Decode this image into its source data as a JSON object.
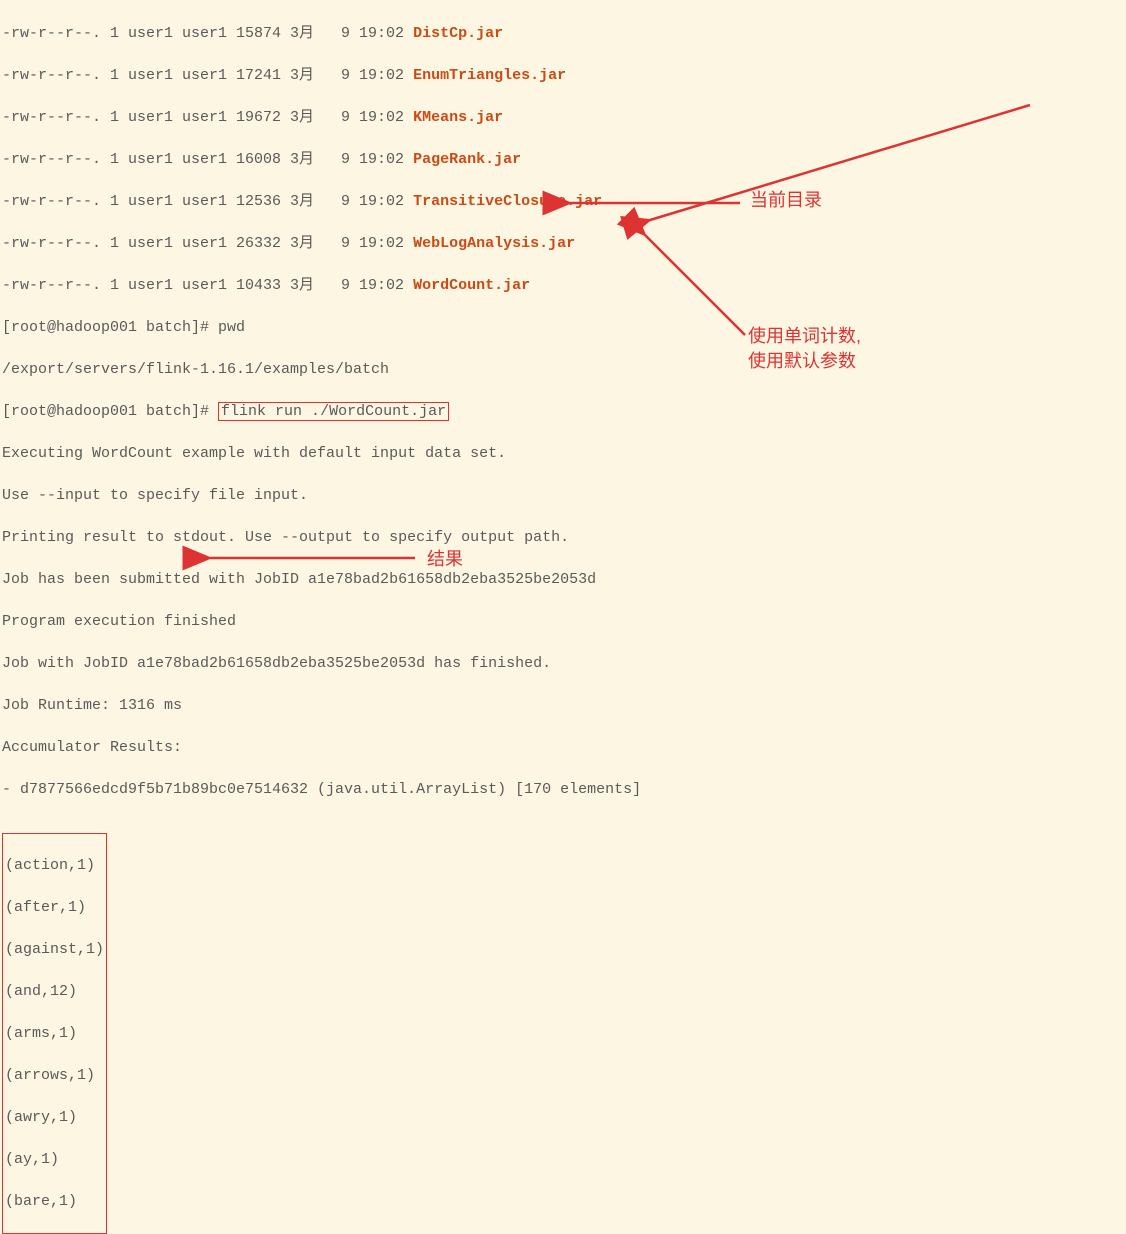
{
  "files": [
    {
      "perms": "-rw-r--r--. 1 user1 user1 15874 3月   9 19:02 ",
      "name": "DistCp.jar"
    },
    {
      "perms": "-rw-r--r--. 1 user1 user1 17241 3月   9 19:02 ",
      "name": "EnumTriangles.jar"
    },
    {
      "perms": "-rw-r--r--. 1 user1 user1 19672 3月   9 19:02 ",
      "name": "KMeans.jar"
    },
    {
      "perms": "-rw-r--r--. 1 user1 user1 16008 3月   9 19:02 ",
      "name": "PageRank.jar"
    },
    {
      "perms": "-rw-r--r--. 1 user1 user1 12536 3月   9 19:02 ",
      "name": "TransitiveClosure.jar"
    },
    {
      "perms": "-rw-r--r--. 1 user1 user1 26332 3月   9 19:02 ",
      "name": "WebLogAnalysis.jar"
    },
    {
      "perms": "-rw-r--r--. 1 user1 user1 10433 3月   9 19:02 ",
      "name": "WordCount.jar"
    }
  ],
  "prompt1": "[root@hadoop001 batch]# pwd",
  "path": "/export/servers/flink-1.16.1/examples/batch",
  "prompt2_prefix": "[root@hadoop001 batch]# ",
  "flink_cmd": "flink run ./WordCount.jar",
  "output": [
    "Executing WordCount example with default input data set.",
    "Use --input to specify file input.",
    "Printing result to stdout. Use --output to specify output path.",
    "Job has been submitted with JobID a1e78bad2b61658db2eba3525be2053d",
    "Program execution finished",
    "Job with JobID a1e78bad2b61658db2eba3525be2053d has finished.",
    "Job Runtime: 1316 ms",
    "Accumulator Results:",
    "- d7877566edcd9f5b71b89bc0e7514632 (java.util.ArrayList) [170 elements]"
  ],
  "results": [
    "(action,1)",
    "(after,1)",
    "(against,1)",
    "(and,12)",
    "(arms,1)",
    "(arrows,1)",
    "(awry,1)",
    "(ay,1)",
    "(bare,1)"
  ],
  "annotations": {
    "current_dir": "当前目录",
    "wordcount_label_line1": "使用单词计数,",
    "wordcount_label_line2": "使用默认参数",
    "result_label": "结果"
  }
}
